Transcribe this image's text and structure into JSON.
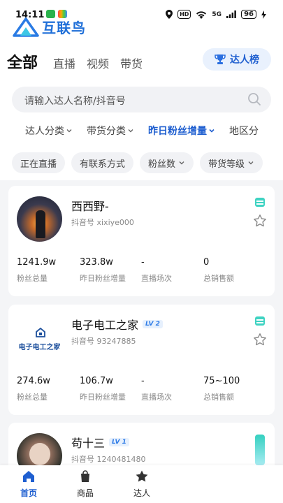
{
  "status_bar": {
    "time": "14:11",
    "network": "5G",
    "battery": "96",
    "hd": "HD"
  },
  "logo": {
    "text": "互联鸟"
  },
  "tabs": [
    {
      "label": "全部",
      "active": true
    },
    {
      "label": "直播"
    },
    {
      "label": "视频"
    },
    {
      "label": "带货"
    }
  ],
  "rank_button": {
    "label": "达人榜",
    "icon": "trophy-icon"
  },
  "search": {
    "placeholder": "请输入达人名称/抖音号",
    "icon": "search-icon"
  },
  "filters": [
    {
      "label": "达人分类"
    },
    {
      "label": "带货分类"
    },
    {
      "label": "昨日粉丝增量",
      "active": true
    },
    {
      "label": "地区分"
    }
  ],
  "chips": [
    {
      "label": "正在直播"
    },
    {
      "label": "有联系方式"
    },
    {
      "label": "粉丝数"
    },
    {
      "label": "带货等级"
    }
  ],
  "stat_labels": {
    "fans": "粉丝总量",
    "yesterday": "昨日粉丝增量",
    "lives": "直播场次",
    "sales": "总销售额"
  },
  "influencers": [
    {
      "name": "西西野-",
      "level": "",
      "douyin_id": "抖音号 xixiye000",
      "fans": "1241.9w",
      "yesterday": "323.8w",
      "lives": "-",
      "sales": "0"
    },
    {
      "name": "电子电工之家",
      "level": "LV 2",
      "douyin_id": "抖音号 93247885",
      "avatar_text": "电子电工之家",
      "fans": "274.6w",
      "yesterday": "106.7w",
      "lives": "-",
      "sales": "75~100"
    },
    {
      "name": "苟十三",
      "level": "LV 1",
      "douyin_id": "抖音号 1240481480"
    }
  ],
  "bottom_nav": [
    {
      "label": "首页",
      "icon": "home-icon",
      "active": true
    },
    {
      "label": "商品",
      "icon": "shopping-bag-icon"
    },
    {
      "label": "达人",
      "icon": "star-icon"
    }
  ],
  "colors": {
    "accent": "#1f5fd0",
    "tag": "#3fd3c2",
    "background": "#f4f5f7"
  }
}
